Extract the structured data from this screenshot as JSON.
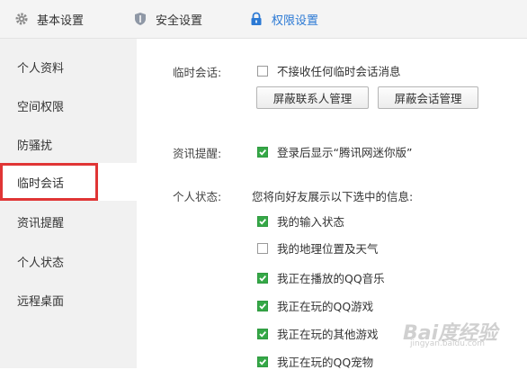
{
  "tabs": [
    {
      "label": "基本设置",
      "icon": "gear-icon"
    },
    {
      "label": "安全设置",
      "icon": "shield-icon"
    },
    {
      "label": "权限设置",
      "icon": "lock-icon"
    }
  ],
  "sidebar": {
    "items": [
      {
        "label": "个人资料"
      },
      {
        "label": "空间权限"
      },
      {
        "label": "防骚扰"
      },
      {
        "label": "临时会话"
      },
      {
        "label": "资讯提醒"
      },
      {
        "label": "个人状态"
      },
      {
        "label": "远程桌面"
      }
    ]
  },
  "temp_session": {
    "label": "临时会话:",
    "option": {
      "text": "不接收任何临时会话消息",
      "checked": false
    },
    "button1": "屏蔽联系人管理",
    "button2": "屏蔽会话管理"
  },
  "news": {
    "label": "资讯提醒:",
    "option": {
      "text": "登录后显示“腾讯网迷你版”",
      "checked": true
    }
  },
  "status": {
    "label": "个人状态:",
    "description": "您将向好友展示以下选中的信息:",
    "options": [
      {
        "text": "我的输入状态",
        "checked": true
      },
      {
        "text": "我的地理位置及天气",
        "checked": false
      },
      {
        "text": "我正在播放的QQ音乐",
        "checked": true
      },
      {
        "text": "我正在玩的QQ游戏",
        "checked": true
      },
      {
        "text": "我正在玩的其他游戏",
        "checked": true
      },
      {
        "text": "我正在玩的QQ宠物",
        "checked": true
      }
    ]
  },
  "watermark": {
    "text": "Bai度经验",
    "sub": "jingyan.baidu.com"
  },
  "colors": {
    "accent": "#2b79d4",
    "check": "#35a847",
    "highlight_border": "#e03535"
  }
}
